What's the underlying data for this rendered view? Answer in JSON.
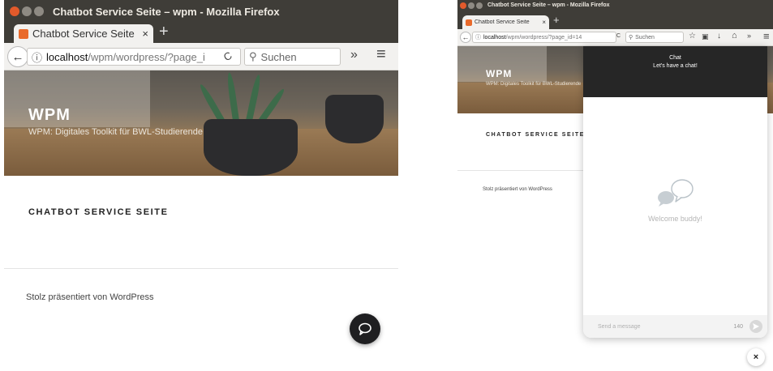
{
  "left": {
    "window_title": "Chatbot Service Seite – wpm - Mozilla Firefox",
    "tab_label": "Chatbot Service Seite",
    "url_host": "localhost",
    "url_path": "/wpm/wordpress/?page_i",
    "search_placeholder": "Suchen",
    "site_name": "WPM",
    "site_description": "WPM: Digitales Toolkit für BWL-Studierende",
    "page_title": "CHATBOT SERVICE SEITE",
    "footer": "Stolz präsentiert von WordPress"
  },
  "right": {
    "window_title": "Chatbot Service Seite – wpm - Mozilla Firefox",
    "tab_label": "Chatbot Service Seite",
    "url_host": "localhost",
    "url_path": "/wpm/wordpress/?page_id=14",
    "search_placeholder": "Suchen",
    "site_name": "WPM",
    "site_description": "WPM: Digitales Toolkit für BWL-Studierende",
    "page_title": "CHATBOT SERVICE SEITE",
    "footer": "Stolz präsentiert von WordPress"
  },
  "chat": {
    "header_title": "Chat",
    "header_subtitle": "Let's have a chat!",
    "welcome": "Welcome buddy!",
    "input_placeholder": "Send a message",
    "char_count": "140",
    "close_glyph": "×"
  },
  "glyphs": {
    "tab_close": "×",
    "new_tab": "+",
    "back": "←",
    "info": "ⓘ",
    "reload": "C",
    "search": "⚲",
    "overflow": "»",
    "menu": "≡",
    "star": "☆",
    "clipboard": "▣",
    "download": "↓",
    "home": "⌂"
  },
  "colors": {
    "titlebar": "#3f3d38",
    "close_button": "#e25a2b",
    "chat_header": "#262626",
    "chat_launcher": "#1f1f21"
  },
  "icons": [
    "chat-bubble-icon",
    "speech-bubbles-icon",
    "send-icon",
    "close-icon"
  ]
}
